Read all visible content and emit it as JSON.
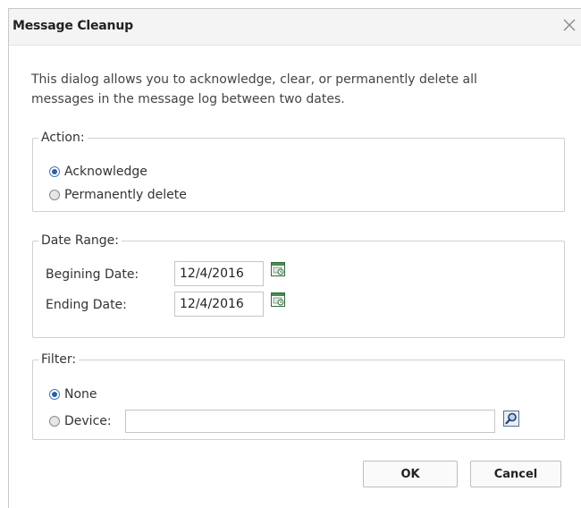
{
  "dialog": {
    "title": "Message Cleanup",
    "description": "This dialog allows you to acknowledge, clear, or permanently delete all messages in the message log between two dates."
  },
  "action": {
    "legend": "Action:",
    "options": [
      {
        "label": "Acknowledge",
        "checked": true
      },
      {
        "label": "Permanently delete",
        "checked": false
      }
    ]
  },
  "date_range": {
    "legend": "Date Range:",
    "beginning_label": "Begining Date:",
    "beginning_value": "12/4/2016",
    "ending_label": "Ending Date:",
    "ending_value": "12/4/2016"
  },
  "filter": {
    "legend": "Filter:",
    "none_label": "None",
    "none_checked": true,
    "device_label": "Device:",
    "device_checked": false,
    "device_value": ""
  },
  "buttons": {
    "ok": "OK",
    "cancel": "Cancel"
  },
  "icons": {
    "close": "close-icon",
    "calendar": "calendar-icon",
    "search": "magnifier-icon"
  },
  "colors": {
    "title_bar": "#f4f4f4",
    "radio_selected": "#2a5fa8"
  }
}
